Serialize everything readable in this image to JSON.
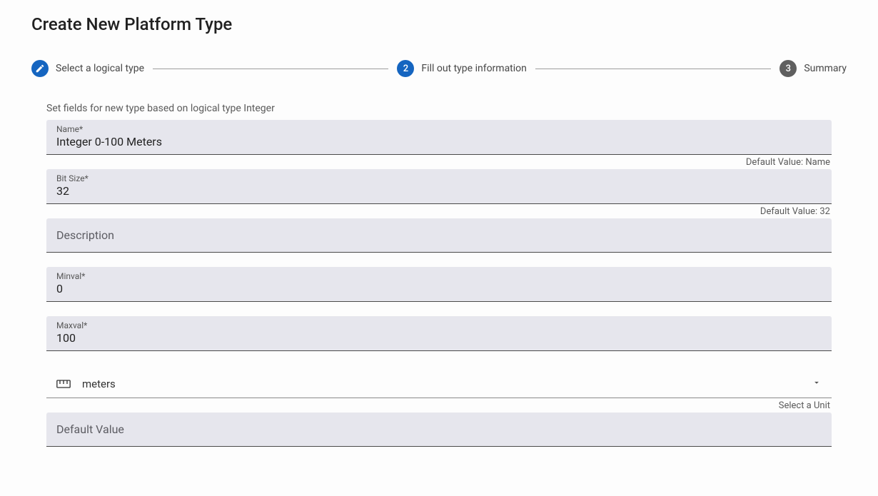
{
  "title": "Create New Platform Type",
  "stepper": {
    "step1": {
      "label": "Select a logical type"
    },
    "step2": {
      "num": "2",
      "label": "Fill out type information"
    },
    "step3": {
      "num": "3",
      "label": "Summary"
    }
  },
  "instruction": "Set fields for new type based on logical type Integer",
  "fields": {
    "name": {
      "label": "Name*",
      "value": "Integer 0-100 Meters",
      "helper": "Default Value: Name"
    },
    "bitsize": {
      "label": "Bit Size*",
      "value": "32",
      "helper": "Default Value: 32"
    },
    "description": {
      "placeholder": "Description"
    },
    "minval": {
      "label": "Minval*",
      "value": "0"
    },
    "maxval": {
      "label": "Maxval*",
      "value": "100"
    },
    "unit": {
      "value": "meters",
      "helper": "Select a Unit"
    },
    "defaultValue": {
      "placeholder": "Default Value"
    }
  }
}
